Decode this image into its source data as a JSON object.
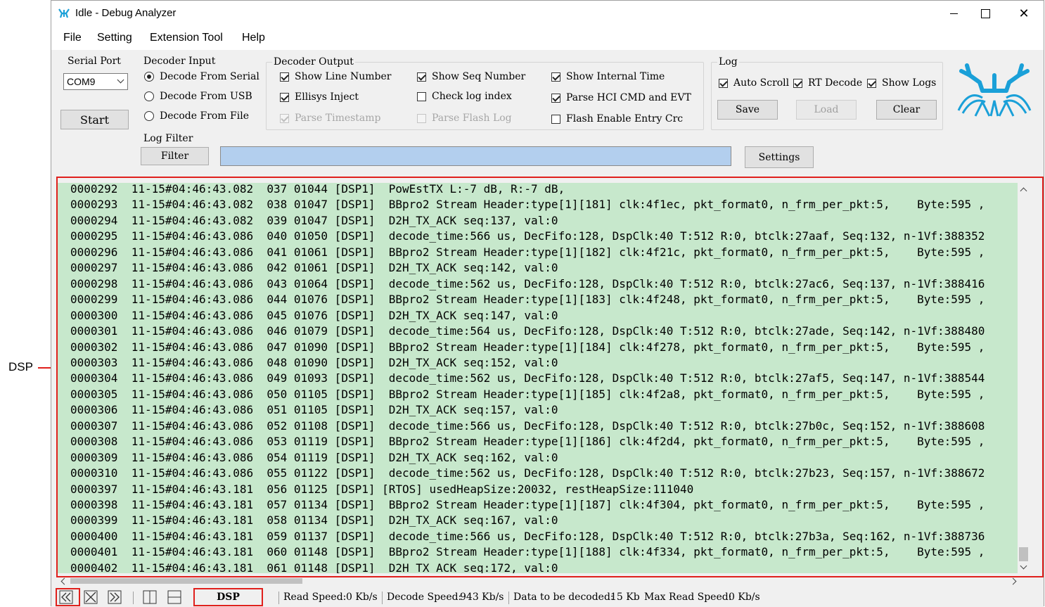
{
  "window": {
    "title": "Idle - Debug Analyzer"
  },
  "menu": [
    "File",
    "Setting",
    "Extension Tool",
    "Help"
  ],
  "serial_port": {
    "label": "Serial Port",
    "value": "COM9",
    "start_label": "Start"
  },
  "decoder_input": {
    "label": "Decoder Input",
    "options": [
      {
        "label": "Decode From Serial",
        "selected": true
      },
      {
        "label": "Decode From USB",
        "selected": false
      },
      {
        "label": "Decode From File",
        "selected": false
      }
    ]
  },
  "decoder_output": {
    "label": "Decoder Output",
    "options": [
      {
        "label": "Show Line Number",
        "checked": true,
        "enabled": true
      },
      {
        "label": "Ellisys Inject",
        "checked": true,
        "enabled": true
      },
      {
        "label": "Parse Timestamp",
        "checked": true,
        "enabled": false
      },
      {
        "label": "Show Seq Number",
        "checked": true,
        "enabled": true
      },
      {
        "label": "Check log index",
        "checked": false,
        "enabled": true
      },
      {
        "label": "Parse Flash Log",
        "checked": false,
        "enabled": false
      },
      {
        "label": "Show Internal Time",
        "checked": true,
        "enabled": true
      },
      {
        "label": "Parse HCI CMD and EVT",
        "checked": true,
        "enabled": true
      },
      {
        "label": "Flash Enable Entry Crc",
        "checked": false,
        "enabled": true
      }
    ]
  },
  "log_group": {
    "label": "Log",
    "options": [
      {
        "label": "Auto Scroll",
        "checked": true
      },
      {
        "label": "RT Decode",
        "checked": true
      },
      {
        "label": "Show Logs",
        "checked": true
      }
    ],
    "save_label": "Save",
    "load_label": "Load",
    "clear_label": "Clear"
  },
  "log_filter": {
    "label": "Log Filter",
    "filter_label": "Filter",
    "value": "",
    "settings_label": "Settings"
  },
  "annotation": {
    "dsp_label": "DSP"
  },
  "log_rows": [
    "0000292  11-15#04:46:43.082  037 01044 [DSP1]  PowEstTX L:-7 dB, R:-7 dB,",
    "0000293  11-15#04:46:43.082  038 01047 [DSP1]  BBpro2 Stream Header:type[1][181] clk:4f1ec, pkt_format0, n_frm_per_pkt:5,    Byte:595 ,",
    "0000294  11-15#04:46:43.082  039 01047 [DSP1]  D2H_TX_ACK seq:137, val:0",
    "0000295  11-15#04:46:43.086  040 01050 [DSP1]  decode_time:566 us, DecFifo:128, DspClk:40 T:512 R:0, btclk:27aaf, Seq:132, n-1Vf:388352",
    "0000296  11-15#04:46:43.086  041 01061 [DSP1]  BBpro2 Stream Header:type[1][182] clk:4f21c, pkt_format0, n_frm_per_pkt:5,    Byte:595 ,",
    "0000297  11-15#04:46:43.086  042 01061 [DSP1]  D2H_TX_ACK seq:142, val:0",
    "0000298  11-15#04:46:43.086  043 01064 [DSP1]  decode_time:562 us, DecFifo:128, DspClk:40 T:512 R:0, btclk:27ac6, Seq:137, n-1Vf:388416",
    "0000299  11-15#04:46:43.086  044 01076 [DSP1]  BBpro2 Stream Header:type[1][183] clk:4f248, pkt_format0, n_frm_per_pkt:5,    Byte:595 ,",
    "0000300  11-15#04:46:43.086  045 01076 [DSP1]  D2H_TX_ACK seq:147, val:0",
    "0000301  11-15#04:46:43.086  046 01079 [DSP1]  decode_time:564 us, DecFifo:128, DspClk:40 T:512 R:0, btclk:27ade, Seq:142, n-1Vf:388480",
    "0000302  11-15#04:46:43.086  047 01090 [DSP1]  BBpro2 Stream Header:type[1][184] clk:4f278, pkt_format0, n_frm_per_pkt:5,    Byte:595 ,",
    "0000303  11-15#04:46:43.086  048 01090 [DSP1]  D2H_TX_ACK seq:152, val:0",
    "0000304  11-15#04:46:43.086  049 01093 [DSP1]  decode_time:562 us, DecFifo:128, DspClk:40 T:512 R:0, btclk:27af5, Seq:147, n-1Vf:388544",
    "0000305  11-15#04:46:43.086  050 01105 [DSP1]  BBpro2 Stream Header:type[1][185] clk:4f2a8, pkt_format0, n_frm_per_pkt:5,    Byte:595 ,",
    "0000306  11-15#04:46:43.086  051 01105 [DSP1]  D2H_TX_ACK seq:157, val:0",
    "0000307  11-15#04:46:43.086  052 01108 [DSP1]  decode_time:566 us, DecFifo:128, DspClk:40 T:512 R:0, btclk:27b0c, Seq:152, n-1Vf:388608",
    "0000308  11-15#04:46:43.086  053 01119 [DSP1]  BBpro2 Stream Header:type[1][186] clk:4f2d4, pkt_format0, n_frm_per_pkt:5,    Byte:595 ,",
    "0000309  11-15#04:46:43.086  054 01119 [DSP1]  D2H_TX_ACK seq:162, val:0",
    "0000310  11-15#04:46:43.086  055 01122 [DSP1]  decode_time:562 us, DecFifo:128, DspClk:40 T:512 R:0, btclk:27b23, Seq:157, n-1Vf:388672",
    "0000397  11-15#04:46:43.181  056 01125 [DSP1] [RTOS] usedHeapSize:20032, restHeapSize:111040",
    "0000398  11-15#04:46:43.181  057 01134 [DSP1]  BBpro2 Stream Header:type[1][187] clk:4f304, pkt_format0, n_frm_per_pkt:5,    Byte:595 ,",
    "0000399  11-15#04:46:43.181  058 01134 [DSP1]  D2H_TX_ACK seq:167, val:0",
    "0000400  11-15#04:46:43.181  059 01137 [DSP1]  decode_time:566 us, DecFifo:128, DspClk:40 T:512 R:0, btclk:27b3a, Seq:162, n-1Vf:388736",
    "0000401  11-15#04:46:43.181  060 01148 [DSP1]  BBpro2 Stream Header:type[1][188] clk:4f334, pkt_format0, n_frm_per_pkt:5,    Byte:595 ,",
    "0000402  11-15#04:46:43.181  061 01148 [DSP1]  D2H_TX_ACK seq:172, val:0"
  ],
  "status": {
    "tab_label": "DSP",
    "read_speed_label": "Read Speed:",
    "read_speed_value": "0 Kb/s",
    "decode_speed_label": "Decode Speed:",
    "decode_speed_value": "943 Kb/s",
    "to_decode_label": "Data to be decoded:",
    "to_decode_value": "15 Kb",
    "max_read_label": "Max Read Speed:",
    "max_read_value": "0 Kb/s"
  },
  "colors": {
    "log_bg": "#c7e8cc",
    "filter_bar": "#b3cfee",
    "highlight": "#e0201c",
    "logo": "#1aa0d8"
  }
}
